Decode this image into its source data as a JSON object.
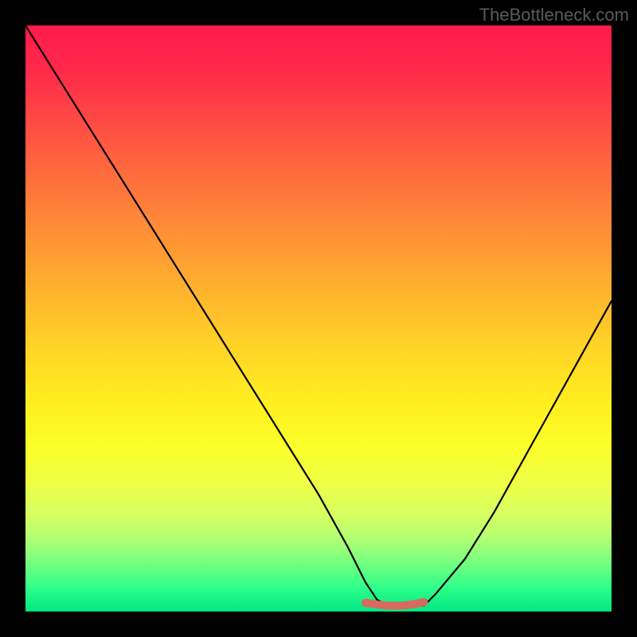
{
  "watermark": "TheBottleneck.com",
  "chart_data": {
    "type": "line",
    "title": "",
    "xlabel": "",
    "ylabel": "",
    "xlim": [
      0,
      100
    ],
    "ylim": [
      0,
      100
    ],
    "series": [
      {
        "name": "bottleneck-curve",
        "x": [
          0,
          5,
          10,
          15,
          20,
          25,
          30,
          35,
          40,
          45,
          50,
          55,
          58,
          60,
          62,
          65,
          68,
          70,
          75,
          80,
          85,
          90,
          95,
          100
        ],
        "y": [
          100,
          92,
          84,
          76,
          68,
          60,
          52,
          44,
          36,
          28,
          20,
          11,
          5,
          2,
          1,
          1,
          1,
          3,
          9,
          17,
          26,
          35,
          44,
          53
        ]
      },
      {
        "name": "sweet-spot-highlight",
        "x": [
          58,
          60,
          62,
          64,
          66,
          68
        ],
        "y": [
          1.5,
          1.2,
          1.0,
          1.0,
          1.2,
          1.6
        ]
      }
    ],
    "gradient_stops": [
      {
        "pos": 0,
        "color": "#ff1a4d"
      },
      {
        "pos": 50,
        "color": "#ffc926"
      },
      {
        "pos": 75,
        "color": "#f5ff30"
      },
      {
        "pos": 100,
        "color": "#00e682"
      }
    ]
  }
}
